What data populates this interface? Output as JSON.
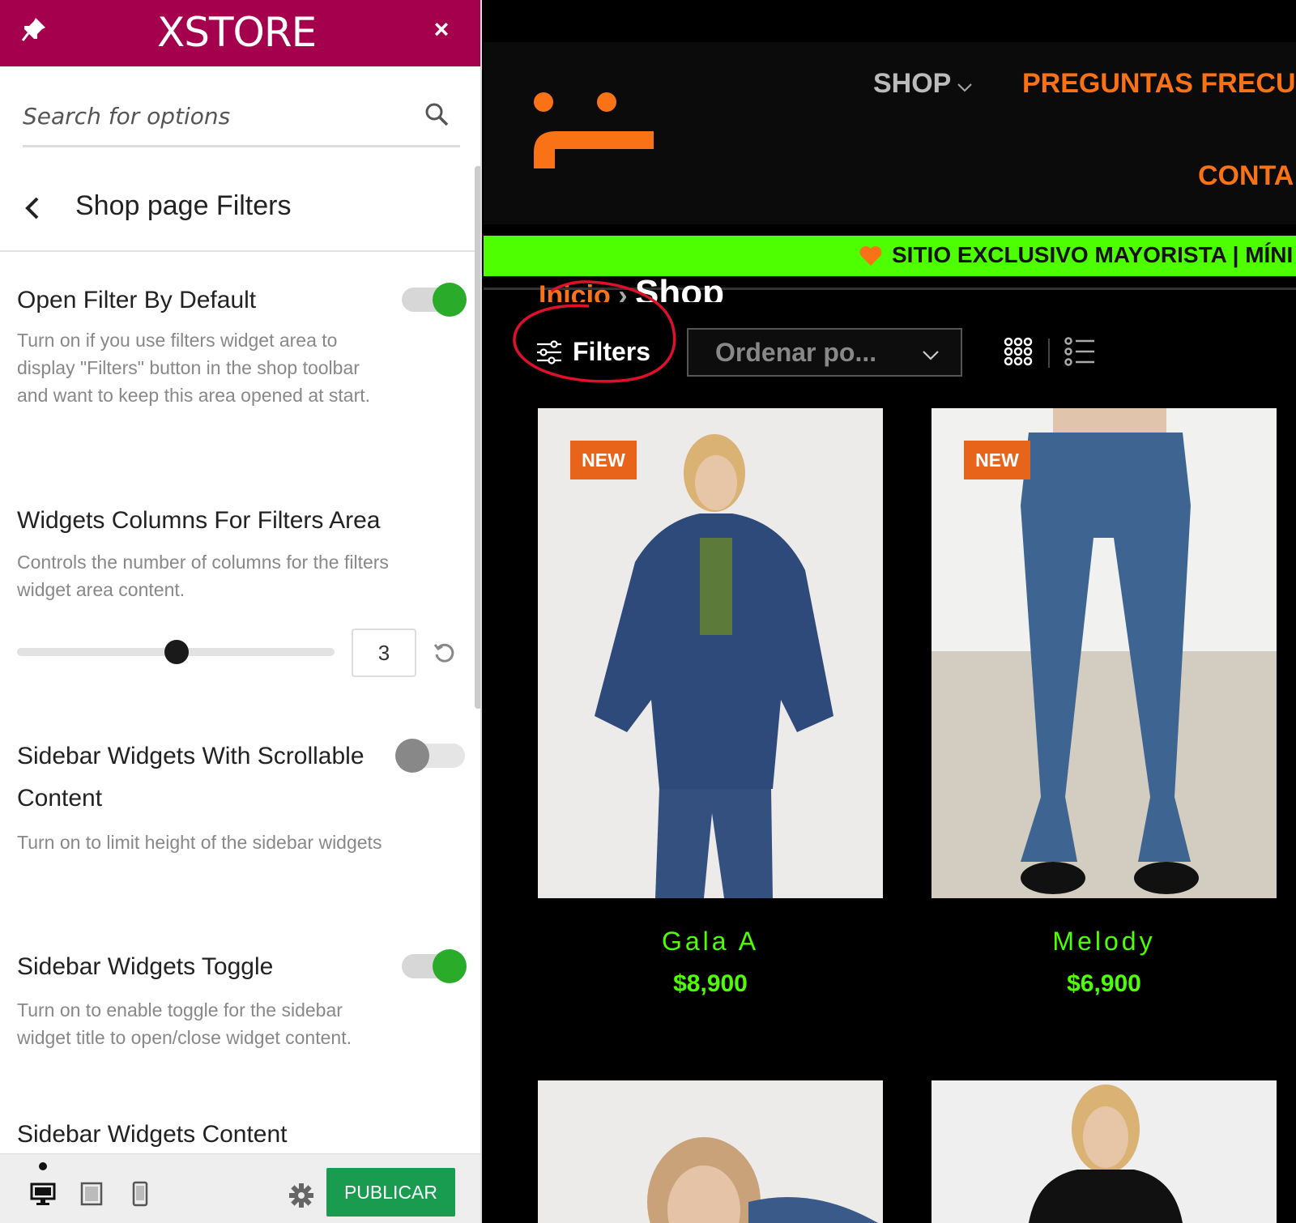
{
  "panel": {
    "brand": "XSTORE",
    "close_label": "×",
    "search": {
      "placeholder": "Search for options",
      "value": ""
    },
    "section_title": "Shop page Filters",
    "options": [
      {
        "title": "Open Filter By Default",
        "description": "Turn on if you use filters widget area to display \"Filters\" button in the shop toolbar and want to keep this area opened at start.",
        "toggle": "on"
      },
      {
        "title": "Widgets Columns For Filters Area",
        "description": "Controls the number of columns for the filters widget area content.",
        "slider_value": "3",
        "slider_fraction": 0.5
      },
      {
        "title": "Sidebar Widgets With Scrollable Content",
        "description": "Turn on to limit height of the sidebar widgets",
        "toggle": "off"
      },
      {
        "title": "Sidebar Widgets Toggle",
        "description": "Turn on to enable toggle for the sidebar widget title to open/close widget content.",
        "toggle": "on"
      },
      {
        "title": "Sidebar Widgets Content",
        "description": ""
      }
    ],
    "bottom": {
      "publish_label": "PUBLICAR",
      "active_device": "desktop"
    },
    "colors": {
      "header": "#a5004d",
      "toggle_on": "#2aab2a",
      "publish": "#1a9c50"
    }
  },
  "store": {
    "nav": {
      "shop": "SHOP",
      "faq": "PREGUNTAS FRECU",
      "contact": "CONTA"
    },
    "announcement": "SITIO EXCLUSIVO MAYORISTA | MÍNI",
    "breadcrumb": {
      "home": "Inicio",
      "separator": "›",
      "current": "Shop"
    },
    "toolbar": {
      "filters_label": "Filters",
      "sort_label": "Ordenar po..."
    },
    "products": [
      {
        "badge": "NEW",
        "name": "Gala A",
        "price": "$8,900"
      },
      {
        "badge": "NEW",
        "name": "Melody",
        "price": "$6,900"
      },
      {
        "badge": "",
        "name": "",
        "price": ""
      },
      {
        "badge": "",
        "name": "",
        "price": ""
      }
    ],
    "colors": {
      "accent": "#f97316",
      "announce_bg": "#4dff00",
      "price": "#4dff00",
      "badge": "#e8641a"
    }
  }
}
